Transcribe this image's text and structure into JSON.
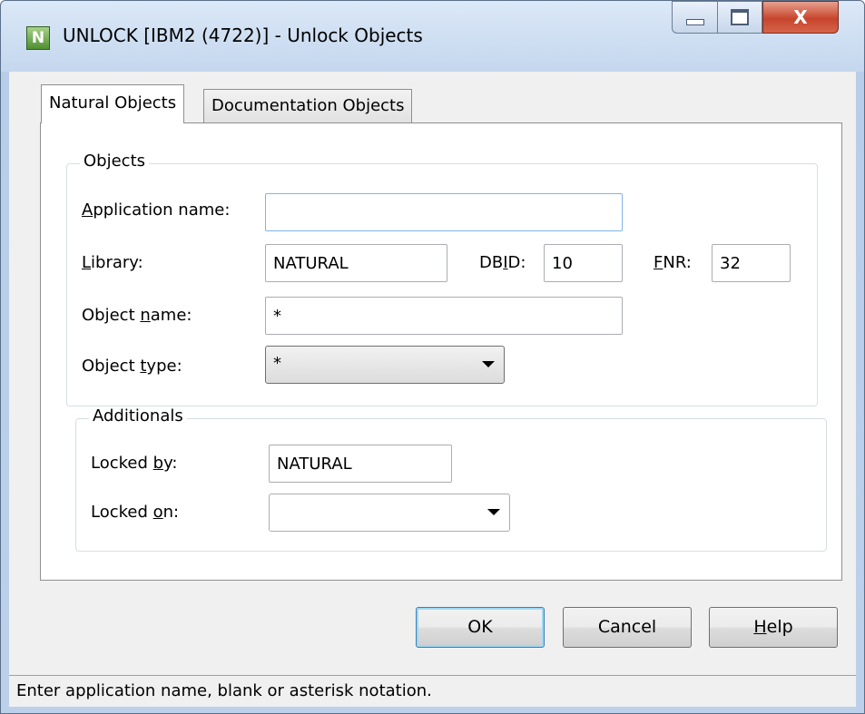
{
  "window": {
    "icon_letter": "N",
    "title": "UNLOCK [IBM2 (4722)] - Unlock Objects",
    "close_glyph": "X"
  },
  "tabs": [
    {
      "label": "Natural Objects",
      "active": true
    },
    {
      "label": "Documentation Objects",
      "active": false
    }
  ],
  "objects_group": {
    "legend": "Objects",
    "application_name": {
      "label_pre": "",
      "label_key": "A",
      "label_post": "pplication name:",
      "value": ""
    },
    "library": {
      "label_pre": "",
      "label_key": "L",
      "label_post": "ibrary:",
      "value": "NATURAL"
    },
    "dbid": {
      "label_pre": "DB",
      "label_key": "I",
      "label_post": "D:",
      "value": "10"
    },
    "fnr": {
      "label_pre": "",
      "label_key": "F",
      "label_post": "NR:",
      "value": "32"
    },
    "object_name": {
      "label_pre": "Object ",
      "label_key": "n",
      "label_post": "ame:",
      "value": "*"
    },
    "object_type": {
      "label_pre": "Object ",
      "label_key": "t",
      "label_post": "ype:",
      "value": "*"
    }
  },
  "additionals_group": {
    "legend": "Additionals",
    "locked_by": {
      "label_pre": "Locked ",
      "label_key": "b",
      "label_post": "y:",
      "value": "NATURAL"
    },
    "locked_on": {
      "label_pre": "Locked ",
      "label_key": "o",
      "label_post": "n:",
      "value": ""
    }
  },
  "buttons": {
    "ok": "OK",
    "cancel": "Cancel",
    "help_pre": "",
    "help_key": "H",
    "help_post": "elp"
  },
  "status": "Enter application name, blank or asterisk notation."
}
